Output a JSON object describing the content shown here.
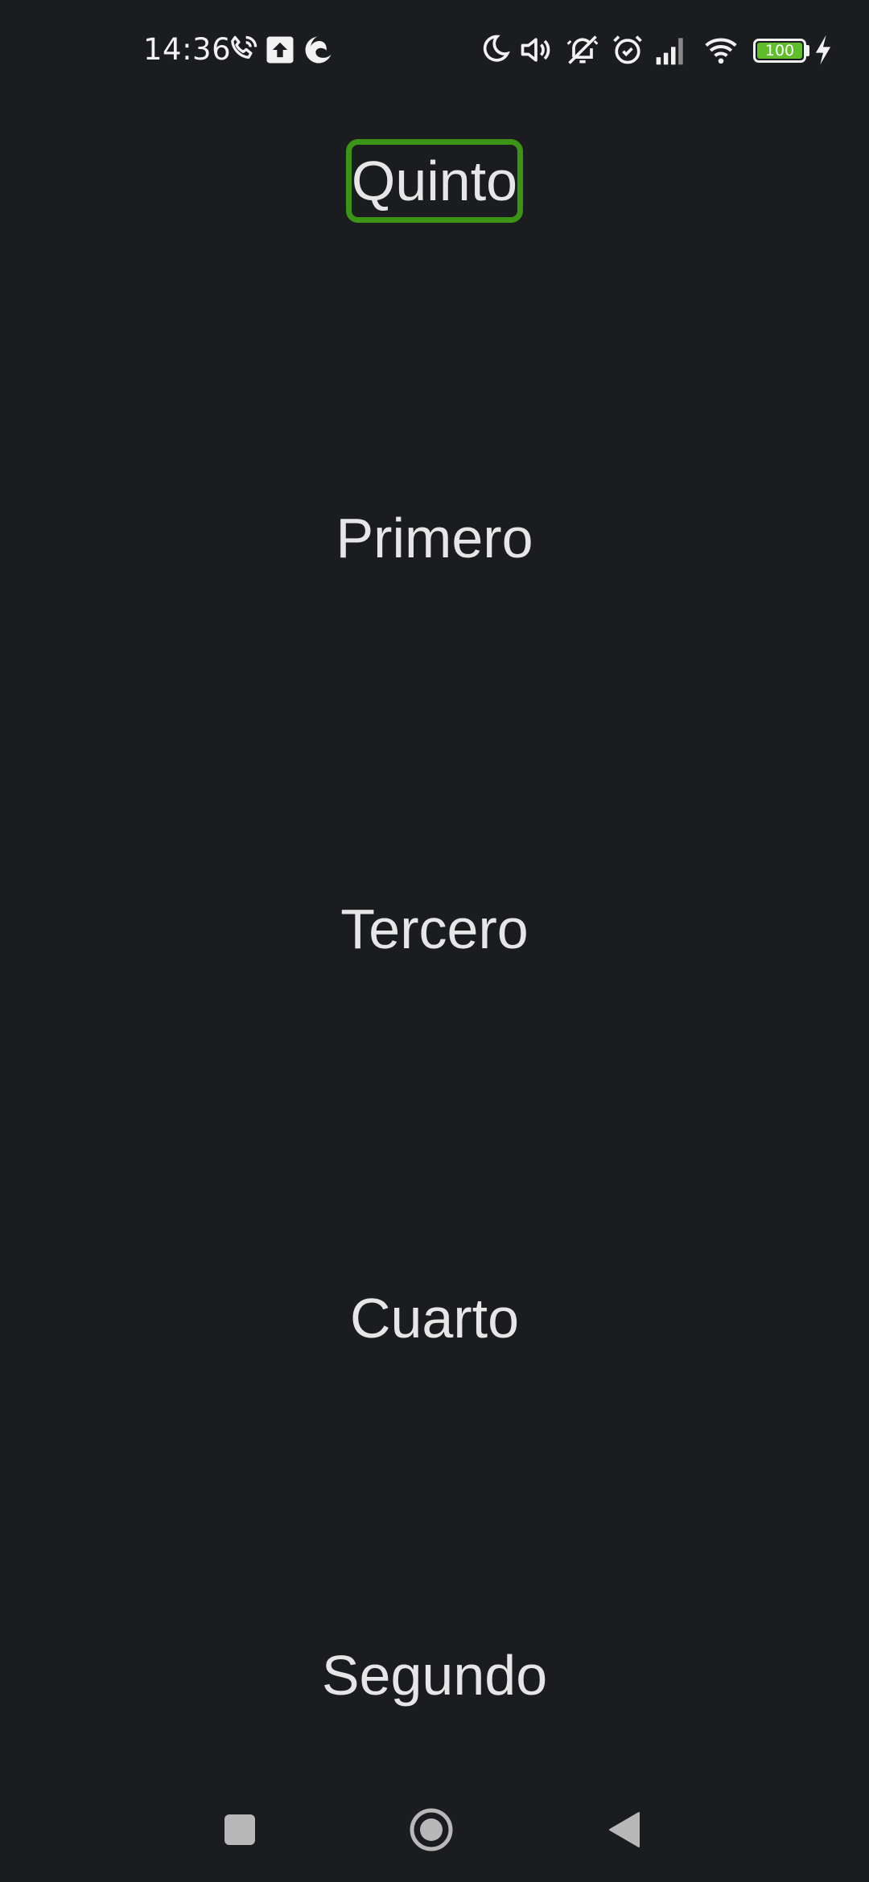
{
  "status_bar": {
    "time": "14:36",
    "battery_level": "100",
    "icons": [
      "phone-call-icon",
      "upload-icon",
      "edge-browser-icon",
      "moon-icon",
      "volume-icon",
      "bell-off-icon",
      "alarm-icon",
      "signal-icon",
      "wifi-icon",
      "battery-icon",
      "charging-icon"
    ],
    "battery_color": "#5fbe2a"
  },
  "list": {
    "items": [
      {
        "label": "Quinto",
        "focused": true
      },
      {
        "label": "Primero",
        "focused": false
      },
      {
        "label": "Tercero",
        "focused": false
      },
      {
        "label": "Cuarto",
        "focused": false
      },
      {
        "label": "Segundo",
        "focused": false
      }
    ],
    "focus_color": "#3b9415"
  },
  "nav_bar": {
    "buttons": [
      "recents-button",
      "home-button",
      "back-button"
    ]
  }
}
